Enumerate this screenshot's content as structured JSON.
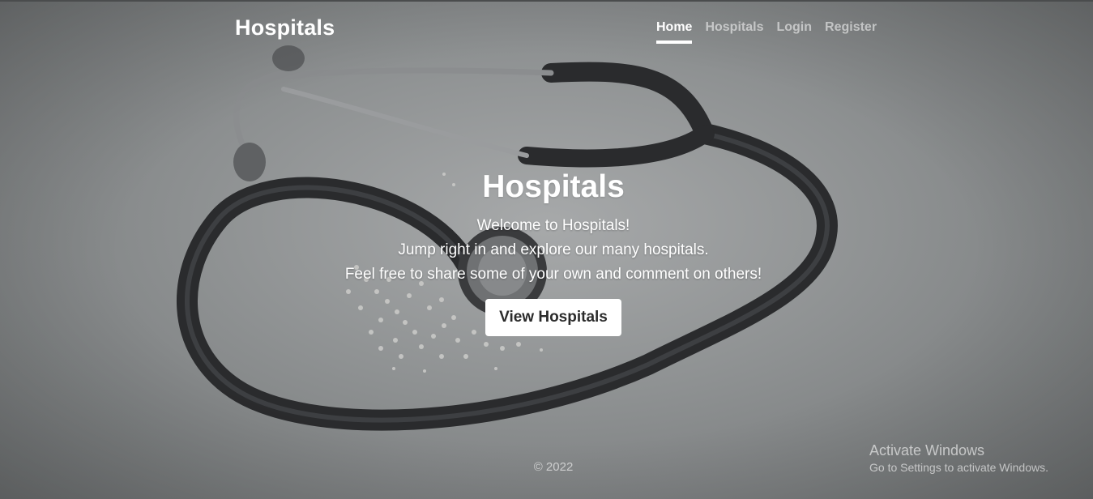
{
  "header": {
    "brand": "Hospitals",
    "nav": [
      {
        "label": "Home",
        "active": true
      },
      {
        "label": "Hospitals",
        "active": false
      },
      {
        "label": "Login",
        "active": false
      },
      {
        "label": "Register",
        "active": false
      }
    ]
  },
  "hero": {
    "title": "Hospitals",
    "lines": [
      "Welcome to Hospitals!",
      "Jump right in and explore our many hospitals.",
      "Feel free to share some of your own and comment on others!"
    ],
    "button_label": "View Hospitals"
  },
  "footer": {
    "copyright": "© 2022"
  },
  "watermark": {
    "title": "Activate Windows",
    "subtitle": "Go to Settings to activate Windows."
  },
  "colors": {
    "text": "#ffffff",
    "nav_inactive": "rgba(255,255,255,0.55)",
    "button_bg": "#ffffff",
    "button_text": "#2b2b2b"
  },
  "background": {
    "icon": "stethoscope-photo"
  }
}
